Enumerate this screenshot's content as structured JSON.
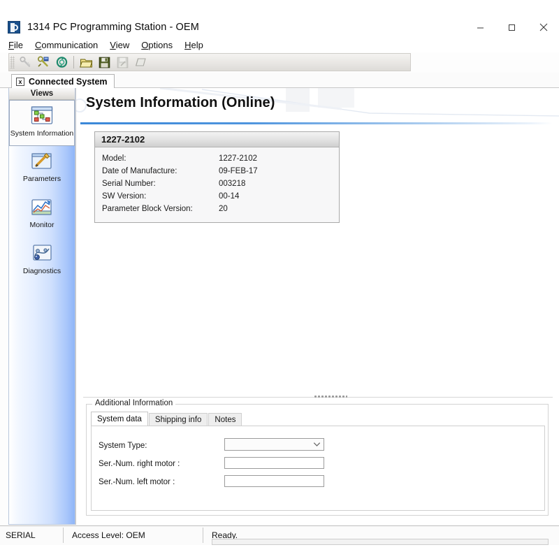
{
  "window": {
    "title": "1314 PC Programming Station - OEM",
    "app_icon": "program-station-icon",
    "minimize_label": "−",
    "maximize_label": "□",
    "close_label": "×"
  },
  "menu": {
    "items": [
      {
        "label": "File",
        "accel": "F"
      },
      {
        "label": "Communication",
        "accel": "C"
      },
      {
        "label": "View",
        "accel": "V"
      },
      {
        "label": "Options",
        "accel": "O"
      },
      {
        "label": "Help",
        "accel": "H"
      }
    ]
  },
  "toolbar": {
    "buttons": [
      {
        "name": "connect-icon",
        "enabled": false
      },
      {
        "name": "disconnect-icon",
        "enabled": true
      },
      {
        "name": "refresh-icon",
        "enabled": true
      },
      {
        "name": "open-folder-icon",
        "enabled": true
      },
      {
        "name": "save-icon",
        "enabled": true
      },
      {
        "name": "save-as-icon",
        "enabled": false
      },
      {
        "name": "clear-icon",
        "enabled": true
      }
    ]
  },
  "doc_tabs": {
    "close_glyph": "x",
    "items": [
      {
        "label": "Connected System",
        "active": true
      }
    ]
  },
  "sidebar": {
    "header": "Views",
    "items": [
      {
        "label": "System Information",
        "icon": "system-information-icon",
        "selected": true
      },
      {
        "label": "Parameters",
        "icon": "parameters-icon",
        "selected": false
      },
      {
        "label": "Monitor",
        "icon": "monitor-icon",
        "selected": false
      },
      {
        "label": "Diagnostics",
        "icon": "diagnostics-icon",
        "selected": false
      }
    ]
  },
  "content": {
    "page_title": "System Information (Online)",
    "accent_color": "#3b88d8",
    "info_card": {
      "header": "1227-2102",
      "rows": [
        {
          "label": "Model:",
          "value": "1227-2102"
        },
        {
          "label": "Date of Manufacture:",
          "value": "09-FEB-17"
        },
        {
          "label": "Serial Number:",
          "value": "003218"
        },
        {
          "label": "SW Version:",
          "value": "00-14"
        },
        {
          "label": "Parameter Block Version:",
          "value": "20"
        }
      ]
    },
    "additional_information": {
      "legend": "Additional Information",
      "tabs": [
        {
          "label": "System data",
          "active": true
        },
        {
          "label": "Shipping info",
          "active": false
        },
        {
          "label": "Notes",
          "active": false
        }
      ],
      "fields": [
        {
          "label": "System Type:",
          "type": "combobox",
          "value": "",
          "placeholder": ""
        },
        {
          "label": "Ser.-Num.  right motor :",
          "type": "text",
          "value": "",
          "placeholder": ""
        },
        {
          "label": "Ser.-Num.  left motor :",
          "type": "text",
          "value": "",
          "placeholder": ""
        }
      ]
    }
  },
  "statusbar": {
    "connection": "SERIAL",
    "access_level": "Access Level: OEM",
    "message": "Ready."
  }
}
